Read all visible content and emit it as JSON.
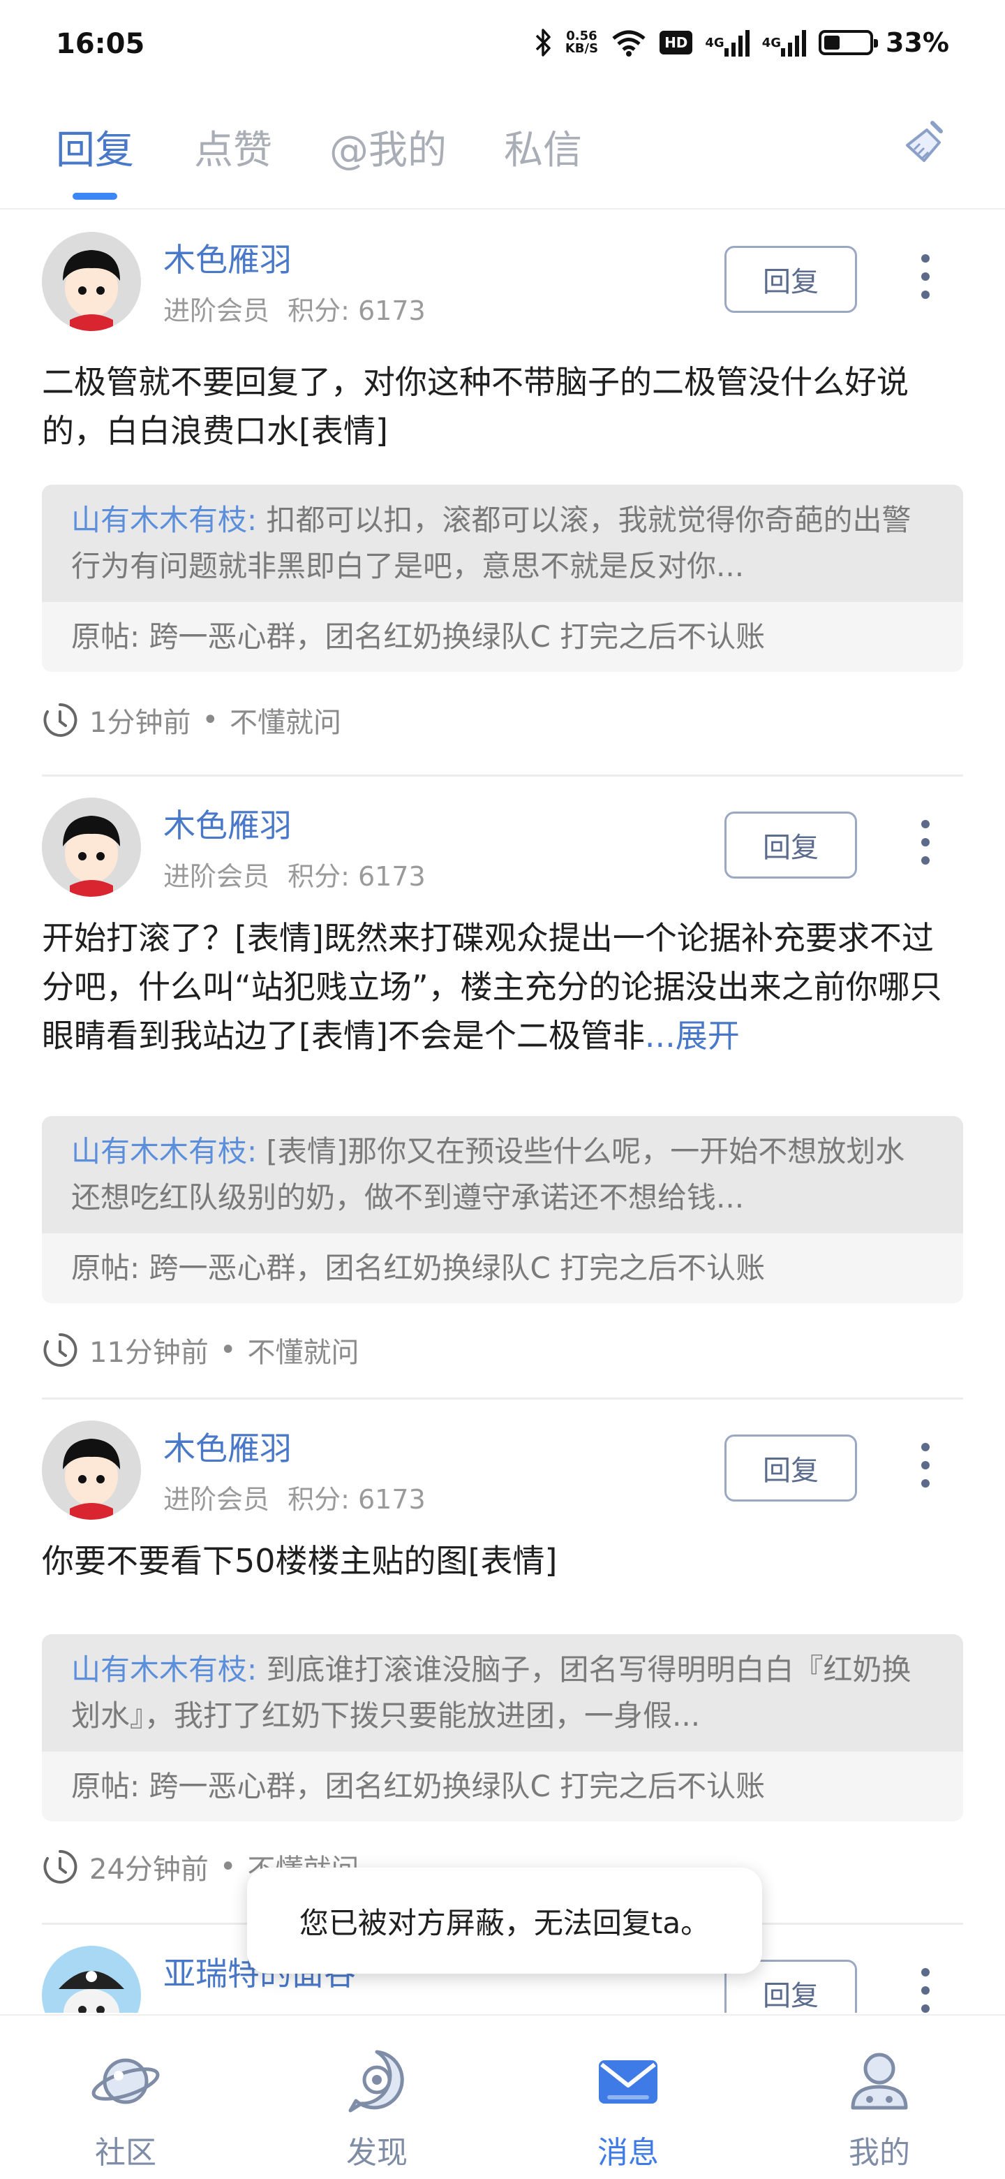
{
  "status_bar": {
    "time": "16:05",
    "net_speed_value": "0.56",
    "net_speed_unit": "KB/S",
    "hd": "HD",
    "net1": "4G",
    "net2": "4G",
    "battery": "33%"
  },
  "tabs": [
    {
      "label": "回复",
      "active": true
    },
    {
      "label": "点赞",
      "active": false
    },
    {
      "label": "@我的",
      "active": false
    },
    {
      "label": "私信",
      "active": false
    }
  ],
  "items": [
    {
      "username": "木色雁羽",
      "member_level": "进阶会员",
      "points": "积分: 6173",
      "reply_label": "回复",
      "content": "二极管就不要回复了，对你这种不带脑子的二极管没什么好说的，白白浪费口水[表情]",
      "expand": "",
      "quote_name": "山有木木有枝:",
      "quote_text": " 扣都可以扣，滚都可以滚，我就觉得你奇葩的出警行为有问题就非黑即白了是吧，意思不就是反对你...",
      "orig_label": "原帖:",
      "orig_text": " 跨一恶心群，团名红奶换绿队C 打完之后不认账",
      "time": "1分钟前",
      "separator": "•",
      "forum": "不懂就问"
    },
    {
      "username": "木色雁羽",
      "member_level": "进阶会员",
      "points": "积分: 6173",
      "reply_label": "回复",
      "content": "开始打滚了？[表情]既然来打碟观众提出一个论据补充要求不过分吧，什么叫“站犯贱立场”，楼主充分的论据没出来之前你哪只眼睛看到我站边了[表情]不会是个二极管非",
      "expand": "...展开",
      "quote_name": "山有木木有枝:",
      "quote_text": " [表情]那你又在预设些什么呢，一开始不想放划水还想吃红队级别的奶，做不到遵守承诺还不想给钱...",
      "orig_label": "原帖:",
      "orig_text": " 跨一恶心群，团名红奶换绿队C 打完之后不认账",
      "time": "11分钟前",
      "separator": "•",
      "forum": "不懂就问"
    },
    {
      "username": "木色雁羽",
      "member_level": "进阶会员",
      "points": "积分: 6173",
      "reply_label": "回复",
      "content": "你要不要看下50楼楼主贴的图[表情]",
      "expand": "",
      "quote_name": "山有木木有枝:",
      "quote_text": " 到底谁打滚谁没脑子，团名写得明明白白『红奶换划水』，我打了红奶下拨只要能放进团，一身假...",
      "orig_label": "原帖:",
      "orig_text": " 跨一恶心群，团名红奶换绿队C 打完之后不认账",
      "time": "24分钟前",
      "separator": "•",
      "forum": "不懂就问"
    },
    {
      "username": "亚瑞特的面谷",
      "reply_label": "回复"
    }
  ],
  "toast": "您已被对方屏蔽，无法回复ta。",
  "bottom_nav": [
    {
      "label": "社区",
      "icon": "planet-icon",
      "active": false
    },
    {
      "label": "发现",
      "icon": "discover-icon",
      "active": false
    },
    {
      "label": "消息",
      "icon": "envelope-icon",
      "active": true
    },
    {
      "label": "我的",
      "icon": "profile-icon",
      "active": false
    }
  ],
  "colors": {
    "accent": "#3d86f5",
    "link": "#4a78c8",
    "quote_name": "#5c8fdb"
  }
}
